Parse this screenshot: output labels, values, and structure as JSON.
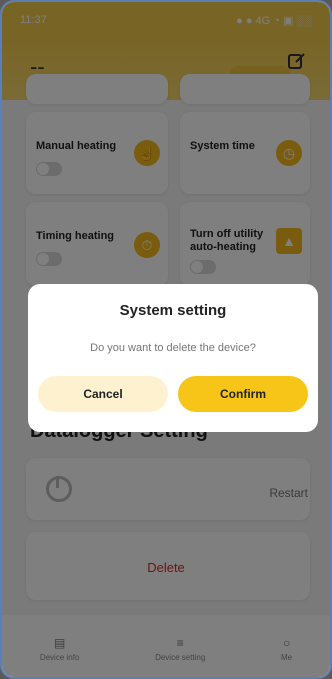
{
  "status_bar": {
    "time": "11:37",
    "right": "● ● 4G ◔ ▣ ░░"
  },
  "header": {
    "back_label": "--",
    "edit_icon": "edit-icon"
  },
  "cards": {
    "manual_heating": "Manual heating",
    "system_time": "System time",
    "timing_heating": "Timing heating",
    "turn_off_utility": "Turn off utility auto-heating"
  },
  "datalogger": {
    "title": "Datalogger Setting",
    "restart_label": "Restart",
    "delete_label": "Delete"
  },
  "tabs": [
    {
      "label": "Device info",
      "icon": "device-icon"
    },
    {
      "label": "Device setting",
      "icon": "settings-icon"
    },
    {
      "label": "Me",
      "icon": "person-icon"
    }
  ],
  "dialog": {
    "title": "System setting",
    "message": "Do you want to delete the device?",
    "cancel_label": "Cancel",
    "confirm_label": "Confirm"
  },
  "colors": {
    "brand": "#f1c84a",
    "confirm": "#f7c518",
    "cancel_bg": "#fdf1cf",
    "danger": "#d12b2b"
  }
}
